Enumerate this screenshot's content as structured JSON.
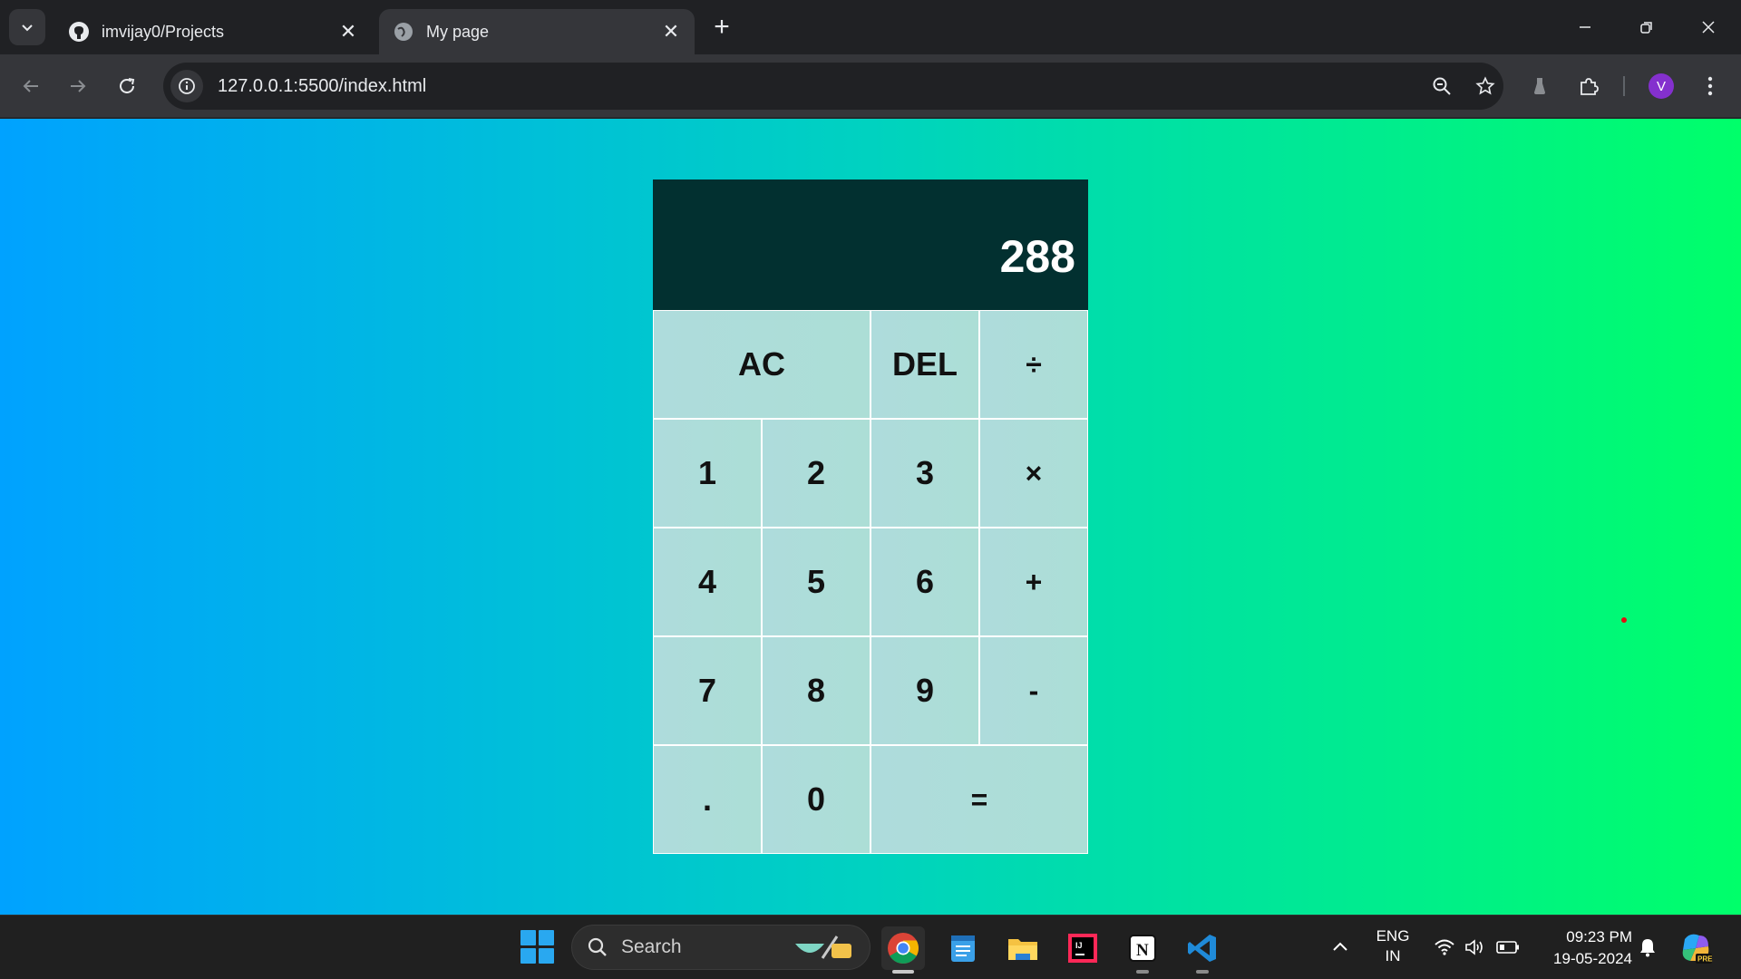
{
  "browser": {
    "tabs": [
      {
        "title": "imvijay0/Projects",
        "icon": "github-icon",
        "active": false
      },
      {
        "title": "My page",
        "icon": "globe-icon",
        "active": true
      }
    ],
    "url": "127.0.0.1:5500/index.html",
    "profile_initial": "V"
  },
  "calculator": {
    "display": "288",
    "keys": [
      "AC",
      "DEL",
      "÷",
      "1",
      "2",
      "3",
      "×",
      "4",
      "5",
      "6",
      "+",
      "7",
      "8",
      "9",
      "-",
      ".",
      "0",
      "="
    ]
  },
  "taskbar": {
    "search_label": "Search",
    "apps": [
      "chrome-icon",
      "notepad-icon",
      "file-explorer-icon",
      "intellij-icon",
      "notion-icon",
      "vscode-icon"
    ],
    "language": {
      "line1": "ENG",
      "line2": "IN"
    },
    "time": "09:23 PM",
    "date": "19-05-2024"
  },
  "colors": {
    "gradient_start": "#00a2ff",
    "gradient_end": "#00ff6a",
    "display_bg": "#023030",
    "key_bg": "#aedcdc"
  }
}
